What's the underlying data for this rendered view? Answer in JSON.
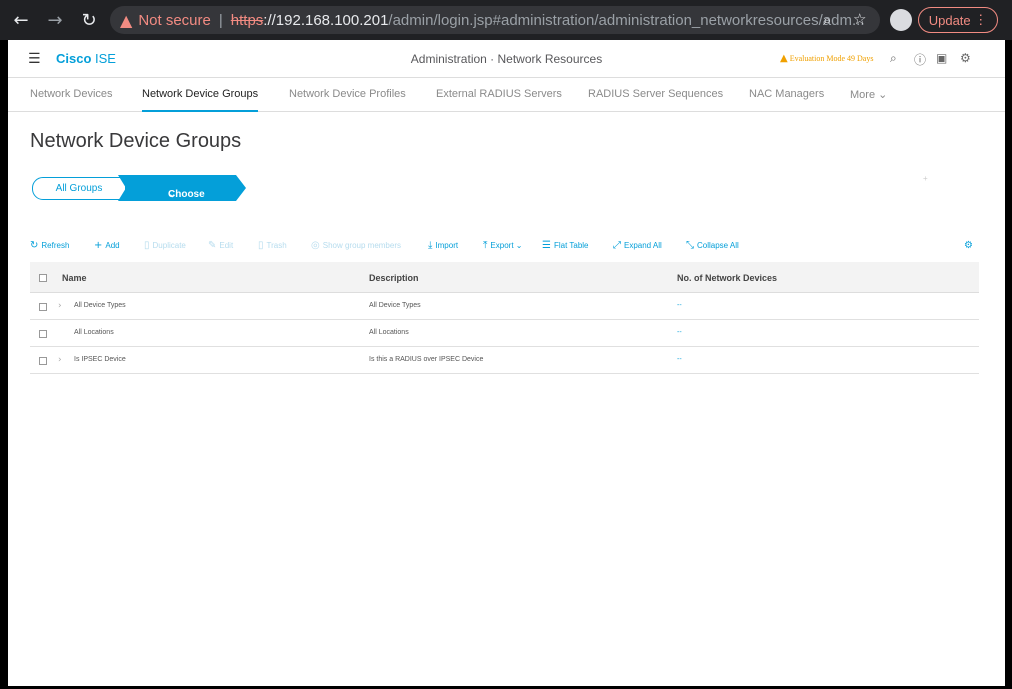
{
  "browser": {
    "back_icon": "arrow-left-icon",
    "forward_icon": "arrow-right-icon",
    "reload_icon": "reload-icon",
    "security_label": "Not secure",
    "url_scheme": "https",
    "url_host": "://192.168.100.201",
    "url_path": "/admin/login.jsp#administration/administration_networkresources/adm...",
    "update_label": "Update"
  },
  "header": {
    "brand_bold": "Cisco",
    "brand_light": " ISE",
    "section_title": "Administration · Network Resources",
    "eval_text": "Evaluation Mode 49 Days"
  },
  "tabs": [
    {
      "label": "Network Devices"
    },
    {
      "label": "Network Device Groups"
    },
    {
      "label": "Network Device Profiles"
    },
    {
      "label": "External RADIUS Servers"
    },
    {
      "label": "RADIUS Server Sequences"
    },
    {
      "label": "NAC Managers"
    },
    {
      "label": "More"
    }
  ],
  "page_title": "Network Device Groups",
  "breadcrumb": {
    "all_groups": "All Groups",
    "choose_group": "Choose group"
  },
  "toolbar": {
    "refresh": "Refresh",
    "add": "Add",
    "duplicate": "Duplicate",
    "edit": "Edit",
    "trash": "Trash",
    "show_members": "Show group members",
    "import": "Import",
    "export": "Export",
    "flat_table": "Flat Table",
    "expand_all": "Expand All",
    "collapse_all": "Collapse All"
  },
  "table": {
    "columns": [
      "Name",
      "Description",
      "No. of Network Devices"
    ],
    "rows": [
      {
        "name": "All Device Types",
        "description": "All Device Types",
        "count": "--"
      },
      {
        "name": "All Locations",
        "description": "All Locations",
        "count": "--"
      },
      {
        "name": "Is IPSEC Device",
        "description": "Is this a RADIUS over IPSEC Device",
        "count": "--"
      }
    ]
  },
  "colors": {
    "accent": "#049fd9",
    "warning": "#f0a000",
    "chrome_bg": "#202124"
  }
}
